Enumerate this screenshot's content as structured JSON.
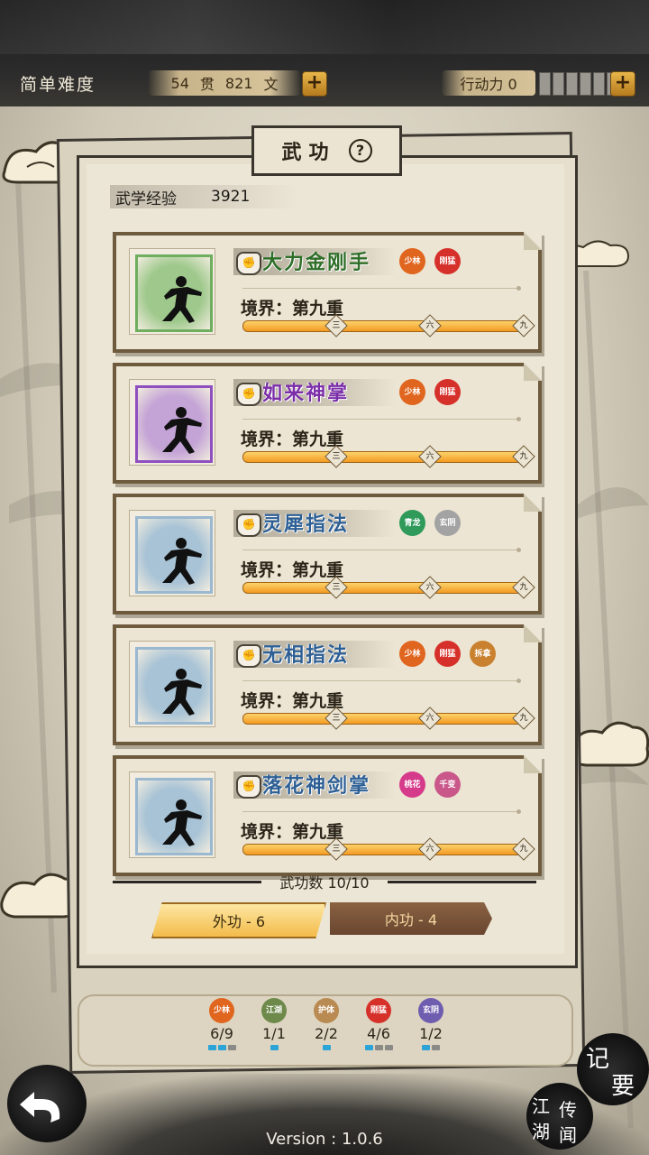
{
  "topbar": {
    "difficulty": "简单难度",
    "money_guan": "54",
    "guan_unit": "贯",
    "money_wen": "821",
    "wen_unit": "文",
    "action_label": "行动力 0",
    "add_symbol": "+"
  },
  "panel": {
    "title": "武功",
    "help_symbol": "?",
    "exp_label": "武学经验",
    "exp_value": "3921"
  },
  "skills": [
    {
      "name": "大力金刚手",
      "name_color": "#2e6e28",
      "frame_color": "#6fae5e",
      "bg_color": "#9fc98c",
      "realm": "境界：第九重",
      "tags": [
        {
          "text": "少林",
          "color": "#e0651e"
        },
        {
          "text": "刚猛",
          "color": "#d6302a"
        }
      ]
    },
    {
      "name": "如来神掌",
      "name_color": "#7b2ea8",
      "frame_color": "#8f4fbf",
      "bg_color": "#c4a3d6",
      "realm": "境界：第九重",
      "tags": [
        {
          "text": "少林",
          "color": "#e0651e"
        },
        {
          "text": "刚猛",
          "color": "#d6302a"
        }
      ]
    },
    {
      "name": "灵犀指法",
      "name_color": "#2d5f94",
      "frame_color": "#9ab8d0",
      "bg_color": "#a8c3d6",
      "realm": "境界：第九重",
      "tags": [
        {
          "text": "青龙",
          "color": "#2f9a5a"
        },
        {
          "text": "玄阴",
          "color": "#a3a3a3"
        }
      ]
    },
    {
      "name": "无相指法",
      "name_color": "#2d5f94",
      "frame_color": "#9ab8d0",
      "bg_color": "#a8c3d6",
      "realm": "境界：第九重",
      "tags": [
        {
          "text": "少林",
          "color": "#e0651e"
        },
        {
          "text": "刚猛",
          "color": "#d6302a"
        },
        {
          "text": "拆拿",
          "color": "#c9812f"
        }
      ]
    },
    {
      "name": "落花神剑掌",
      "name_color": "#2d5f94",
      "frame_color": "#9ab8d0",
      "bg_color": "#a8c3d6",
      "realm": "境界：第九重",
      "tags": [
        {
          "text": "桃花",
          "color": "#d63a8a"
        },
        {
          "text": "千变",
          "color": "#c9578a"
        }
      ]
    }
  ],
  "progress_marks": [
    "三",
    "六",
    "九"
  ],
  "progress_fraction": 1.0,
  "summary": {
    "count_label": "武功数 10/10",
    "tab_external": "外功 - 6",
    "tab_internal": "内功 - 4"
  },
  "sects": [
    {
      "text": "少林",
      "color": "#e0651e",
      "count": "6/9",
      "pips": [
        true,
        true,
        false
      ]
    },
    {
      "text": "江湖",
      "color": "#6e8a4a",
      "count": "1/1",
      "pips": [
        true
      ]
    },
    {
      "text": "护体",
      "color": "#b98a52",
      "count": "2/2",
      "pips": [
        true
      ]
    },
    {
      "text": "刚猛",
      "color": "#d6302a",
      "count": "4/6",
      "pips": [
        true,
        false,
        false
      ]
    },
    {
      "text": "玄阴",
      "color": "#6f5db0",
      "count": "1/2",
      "pips": [
        true,
        false
      ]
    }
  ],
  "footer": {
    "version": "Version : 1.0.6",
    "note_top": "记",
    "note_bottom": "要",
    "news_a": "江",
    "news_b": "传",
    "news_c": "湖",
    "news_d": "闻"
  }
}
